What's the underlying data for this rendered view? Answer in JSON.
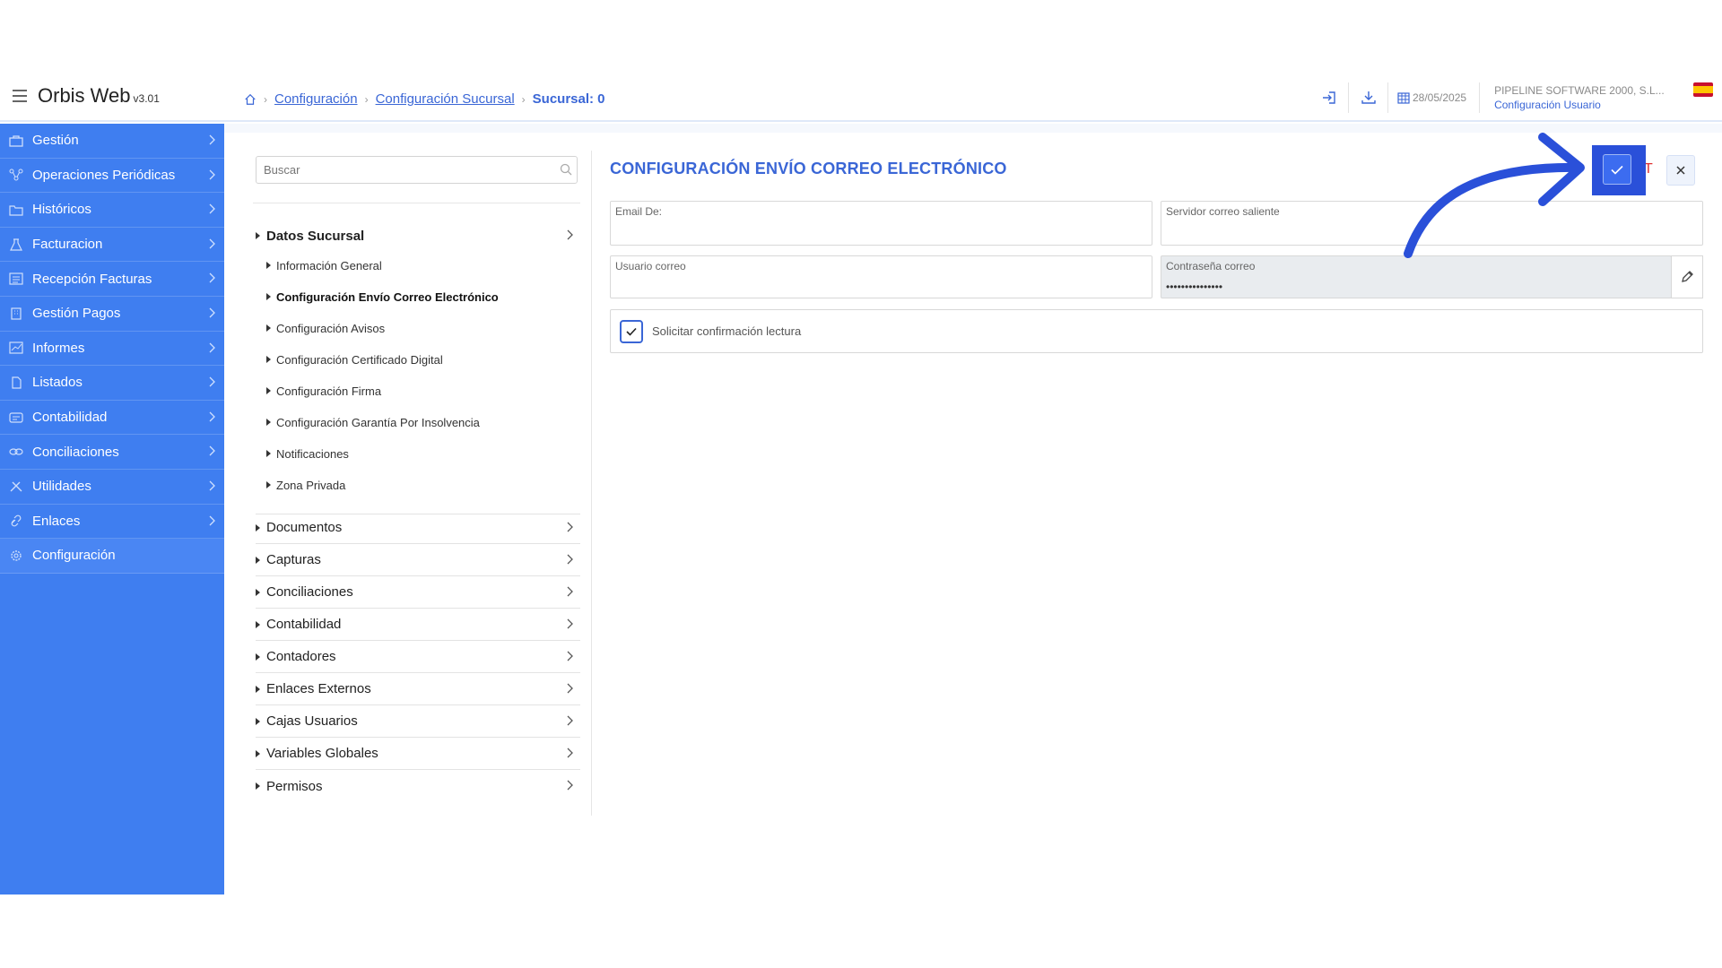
{
  "app": {
    "name": "Orbis Web",
    "version": "v3.01"
  },
  "breadcrumb": {
    "items": [
      "Configuración",
      "Configuración Sucursal"
    ],
    "current": "Sucursal: 0"
  },
  "header": {
    "date": "28/05/2025",
    "company": "PIPELINE SOFTWARE 2000, S.L...",
    "user_config_link": "Configuración Usuario"
  },
  "sidebar": {
    "items": [
      {
        "label": "Gestión",
        "icon": "briefcase-icon"
      },
      {
        "label": "Operaciones Periódicas",
        "icon": "network-icon"
      },
      {
        "label": "Históricos",
        "icon": "folder-icon"
      },
      {
        "label": "Facturacion",
        "icon": "flask-icon"
      },
      {
        "label": "Recepción Facturas",
        "icon": "list-icon"
      },
      {
        "label": "Gestión Pagos",
        "icon": "building-icon"
      },
      {
        "label": "Informes",
        "icon": "chart-icon"
      },
      {
        "label": "Listados",
        "icon": "document-icon"
      },
      {
        "label": "Contabilidad",
        "icon": "ledger-icon"
      },
      {
        "label": "Conciliaciones",
        "icon": "link-icon"
      },
      {
        "label": "Utilidades",
        "icon": "tools-icon"
      },
      {
        "label": "Enlaces",
        "icon": "chain-icon"
      },
      {
        "label": "Configuración",
        "icon": "gear-icon"
      }
    ]
  },
  "tree": {
    "search_placeholder": "Buscar",
    "open_section": "Datos Sucursal",
    "children": [
      "Información General",
      "Configuración Envío Correo Electrónico",
      "Configuración Avisos",
      "Configuración Certificado Digital",
      "Configuración Firma",
      "Configuración Garantía Por Insolvencia",
      "Notificaciones",
      "Zona Privada"
    ],
    "sections": [
      "Documentos",
      "Capturas",
      "Conciliaciones",
      "Contabilidad",
      "Contadores",
      "Enlaces Externos",
      "Cajas Usuarios",
      "Variables Globales",
      "Permisos"
    ]
  },
  "form": {
    "title": "CONFIGURACIÓN ENVÍO CORREO ELECTRÓNICO",
    "fields": {
      "email_from": {
        "label": "Email De:",
        "value": ""
      },
      "smtp_server": {
        "label": "Servidor correo saliente",
        "value": ""
      },
      "mail_user": {
        "label": "Usuario correo",
        "value": ""
      },
      "mail_password": {
        "label": "Contraseña correo",
        "value": "•••••••••••••••"
      }
    },
    "read_receipt": {
      "label": "Solicitar confirmación lectura",
      "checked": true
    },
    "red_letter": "T"
  },
  "colors": {
    "sidebar": "#3f7ef0",
    "accent": "#3a66d6",
    "highlight": "#2a50d9"
  }
}
